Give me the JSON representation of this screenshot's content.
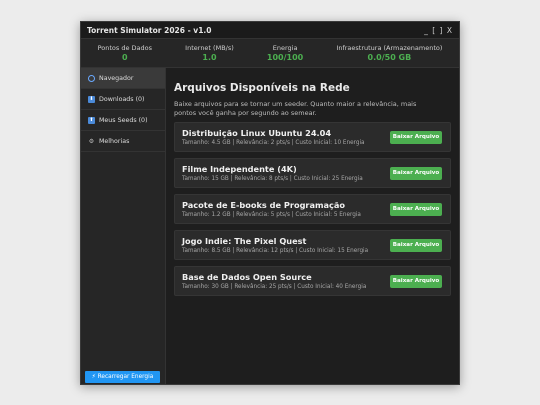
{
  "window": {
    "title": "Torrent Simulator 2026 - v1.0",
    "controls": "_ [ ] X"
  },
  "stats": [
    {
      "label": "Pontos de Dados",
      "value": "0"
    },
    {
      "label": "Internet (MB/s)",
      "value": "1.0"
    },
    {
      "label": "Energia",
      "value": "100/100"
    },
    {
      "label": "Infraestrutura (Armazenamento)",
      "value": "0.0/50 GB"
    }
  ],
  "sidebar": {
    "items": [
      {
        "icon": "globe-icon",
        "label": "Navegador"
      },
      {
        "icon": "download-icon",
        "label": "Downloads (0)"
      },
      {
        "icon": "upload-icon",
        "label": "Meus Seeds (0)"
      },
      {
        "icon": "gear-icon",
        "label": "Melhorias"
      }
    ],
    "recharge_label": "⚡ Recarregar Energia"
  },
  "main": {
    "title": "Arquivos Disponíveis na Rede",
    "intro": "Baixe arquivos para se tornar um seeder. Quanto maior a relevância, mais pontos você ganha por segundo ao semear.",
    "files": [
      {
        "name": "Distribuição Linux Ubuntu 24.04",
        "meta": "Tamanho: 4.5 GB | Relevância: 2 pts/s | Custo Inicial: 10 Energia",
        "button": "Baixar Arquivo"
      },
      {
        "name": "Filme Independente (4K)",
        "meta": "Tamanho: 15 GB | Relevância: 8 pts/s | Custo Inicial: 25 Energia",
        "button": "Baixar Arquivo"
      },
      {
        "name": "Pacote de E-books de Programação",
        "meta": "Tamanho: 1.2 GB | Relevância: 5 pts/s | Custo Inicial: 5 Energia",
        "button": "Baixar Arquivo"
      },
      {
        "name": "Jogo Indie: The Pixel Quest",
        "meta": "Tamanho: 8.5 GB | Relevância: 12 pts/s | Custo Inicial: 15 Energia",
        "button": "Baixar Arquivo"
      },
      {
        "name": "Base de Dados Open Source",
        "meta": "Tamanho: 30 GB | Relevância: 25 pts/s | Custo Inicial: 40 Energia",
        "button": "Baixar Arquivo"
      }
    ]
  },
  "colors": {
    "accent_green": "#4caf50",
    "accent_blue": "#2196f3",
    "background": "#1e1e1e"
  }
}
